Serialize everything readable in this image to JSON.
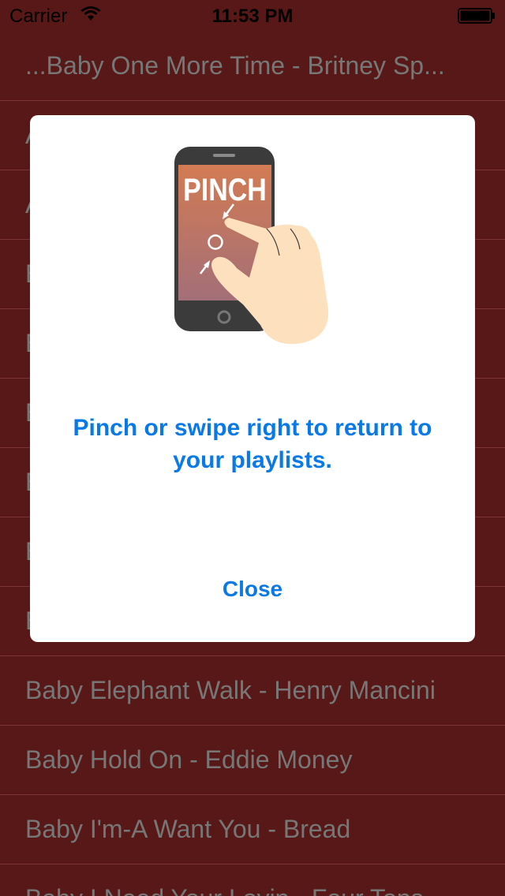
{
  "status_bar": {
    "carrier": "Carrier",
    "time": "11:53 PM",
    "wifi_icon": "wifi-icon",
    "battery_icon": "battery-icon"
  },
  "songs": [
    "...Baby One More Time - Britney Sp...",
    "A",
    "A",
    "B",
    "B",
    "B",
    "B",
    "B",
    "B",
    "Baby Elephant Walk - Henry Mancini",
    "Baby Hold On - Eddie Money",
    "Baby I'm-A Want You - Bread",
    "Baby I Need Your Lovin - Four Tops"
  ],
  "modal": {
    "illustration_text": "PINCH",
    "illustration_icon": "pinch-gesture-icon",
    "message": "Pinch or swipe right to return to your playlists.",
    "close_label": "Close"
  },
  "colors": {
    "list_background": "#581818",
    "list_text": "#777777",
    "accent": "#0a79e8",
    "modal_background": "#ffffff"
  }
}
